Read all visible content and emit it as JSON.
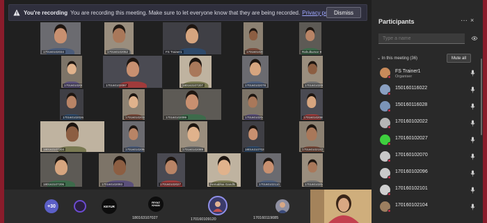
{
  "banner": {
    "title": "You're recording",
    "message": "You are recording this meeting. Make sure to let everyone know that they are being recorded.",
    "link": "Privacy policy",
    "dismiss": "Dismiss"
  },
  "tiles": [
    {
      "name": "170160102034"
    },
    {
      "name": "170160102052"
    },
    {
      "name": "FS Trainer1"
    },
    {
      "name": "170160102022"
    },
    {
      "name": "Rahulkumar Bhavsar"
    },
    {
      "name": "170160102087"
    },
    {
      "name": "170160102097"
    },
    {
      "name": "180163107207"
    },
    {
      "name": "170160102078"
    },
    {
      "name": "170160102080"
    },
    {
      "name": "170160102026"
    },
    {
      "name": "170160102038"
    },
    {
      "name": "170160102099"
    },
    {
      "name": "170160102047"
    },
    {
      "name": "170160102089"
    },
    {
      "name": "180163107204"
    },
    {
      "name": "170160102084"
    },
    {
      "name": "170160102089"
    },
    {
      "name": "180163107028"
    },
    {
      "name": "170160102152"
    },
    {
      "name": "180163107206"
    },
    {
      "name": "170160102093"
    },
    {
      "name": "170160102027"
    },
    {
      "name": "Hemabhai Gandhi"
    },
    {
      "name": "170160102110"
    },
    {
      "name": "170160102045"
    }
  ],
  "strip": {
    "overflow": "+30",
    "keyur_label": "KEYUR",
    "riyaz_label": "RIYAZ KHAN",
    "label1": "180163107027",
    "label2": "170160109120",
    "label3": "170160119085"
  },
  "panel": {
    "title": "Participants",
    "more": "···",
    "close": "×",
    "search_placeholder": "Type a name",
    "section": "In this meeting (36)",
    "mute_all": "Mute all",
    "participants": [
      {
        "name": "FS Trainer1",
        "role": "Organiser",
        "color": "#c88a5a"
      },
      {
        "name": "150160116022",
        "role": "",
        "color": "#8aa0c2"
      },
      {
        "name": "150160116028",
        "role": "",
        "color": "#7b94b8"
      },
      {
        "name": "170160102022",
        "role": "",
        "color": "#b5b5b5"
      },
      {
        "name": "170160102027",
        "role": "",
        "color": "#3ecf3e"
      },
      {
        "name": "170160102070",
        "role": "",
        "color": "#c7c7c7"
      },
      {
        "name": "170160102096",
        "role": "",
        "color": "#c9c9c9"
      },
      {
        "name": "170160102101",
        "role": "",
        "color": "#cfcfcf"
      },
      {
        "name": "170160102104",
        "role": "",
        "color": "#9c7f60"
      }
    ]
  },
  "colors": {
    "accent": "#9ea7ff",
    "frame": "#8a1c2b",
    "status_busy": "#c4314b"
  }
}
